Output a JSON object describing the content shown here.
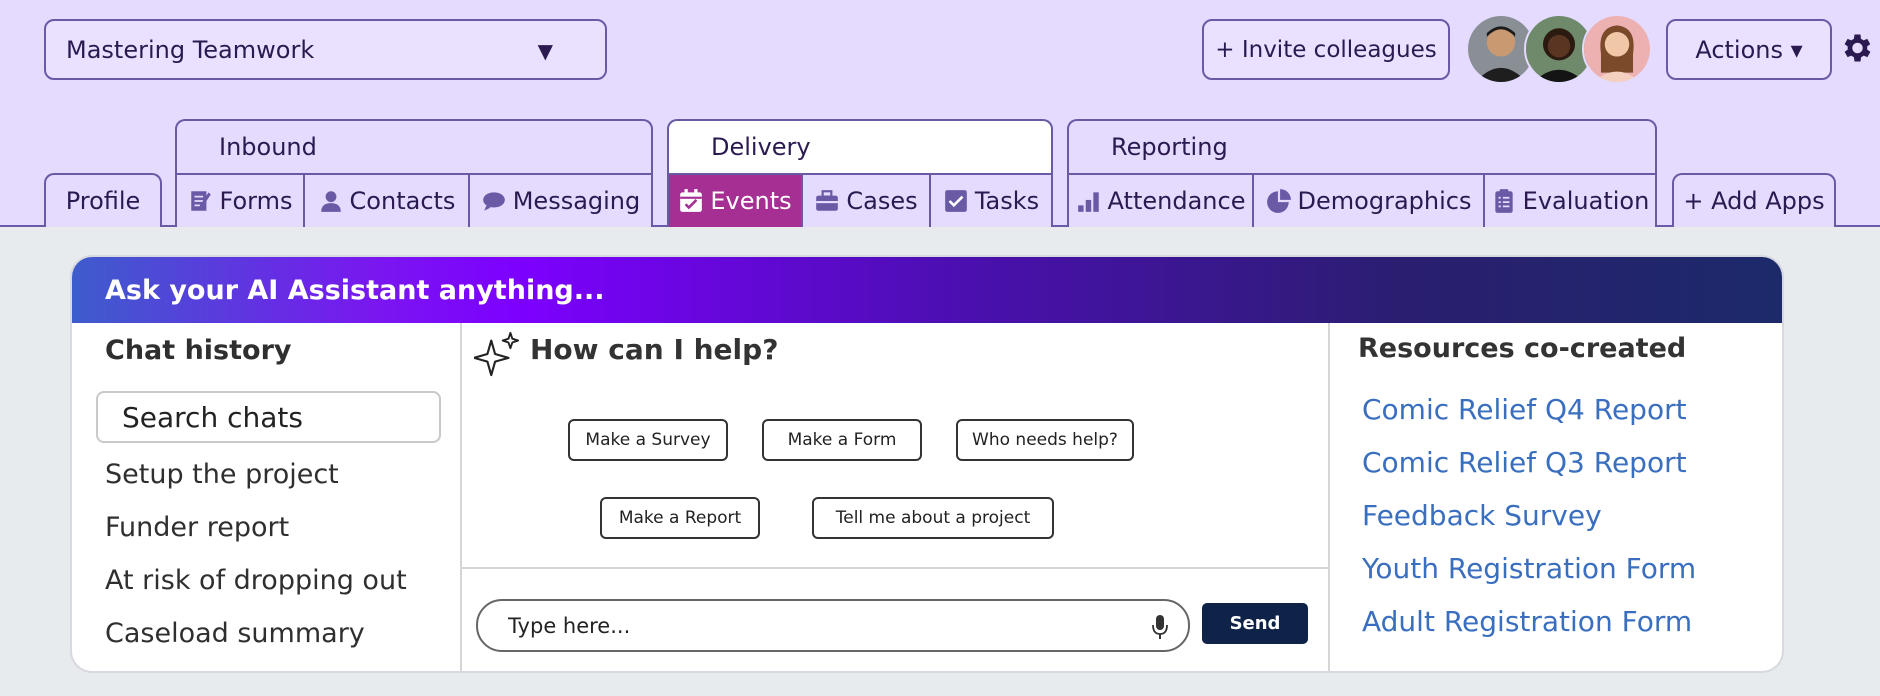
{
  "header": {
    "project_name": "Mastering Teamwork",
    "invite_label": "+ Invite colleagues",
    "actions_label": "Actions ▾"
  },
  "tabs": {
    "profile": "Profile",
    "add_apps": "+ Add Apps",
    "groups": [
      {
        "label": "Inbound",
        "items": [
          "Forms",
          "Contacts",
          "Messaging"
        ]
      },
      {
        "label": "Delivery",
        "items": [
          "Events",
          "Cases",
          "Tasks"
        ],
        "active_item": "Events"
      },
      {
        "label": "Reporting",
        "items": [
          "Attendance",
          "Demographics",
          "Evaluation"
        ]
      }
    ]
  },
  "assistant": {
    "banner": "Ask your AI Assistant anything...",
    "chat_history": {
      "title": "Chat history",
      "search_placeholder": "Search chats",
      "items": [
        "Setup the project",
        "Funder report",
        "At risk of dropping out",
        "Caseload summary"
      ]
    },
    "help": {
      "title": "How can I help?",
      "suggestions": [
        "Make a Survey",
        "Make a Form",
        "Who needs help?",
        "Make a Report",
        "Tell me about a project"
      ],
      "input_placeholder": "Type here...",
      "send_label": "Send"
    },
    "resources": {
      "title": "Resources co-created",
      "links": [
        "Comic Relief Q4 Report",
        "Comic Relief Q3 Report",
        "Feedback Survey",
        "Youth Registration Form",
        "Adult Registration Form"
      ]
    }
  },
  "colors": {
    "header_bg": "#e4dbff",
    "active_tab": "#a62f93",
    "send_button": "#0f2348",
    "link": "#3a6fc0"
  }
}
